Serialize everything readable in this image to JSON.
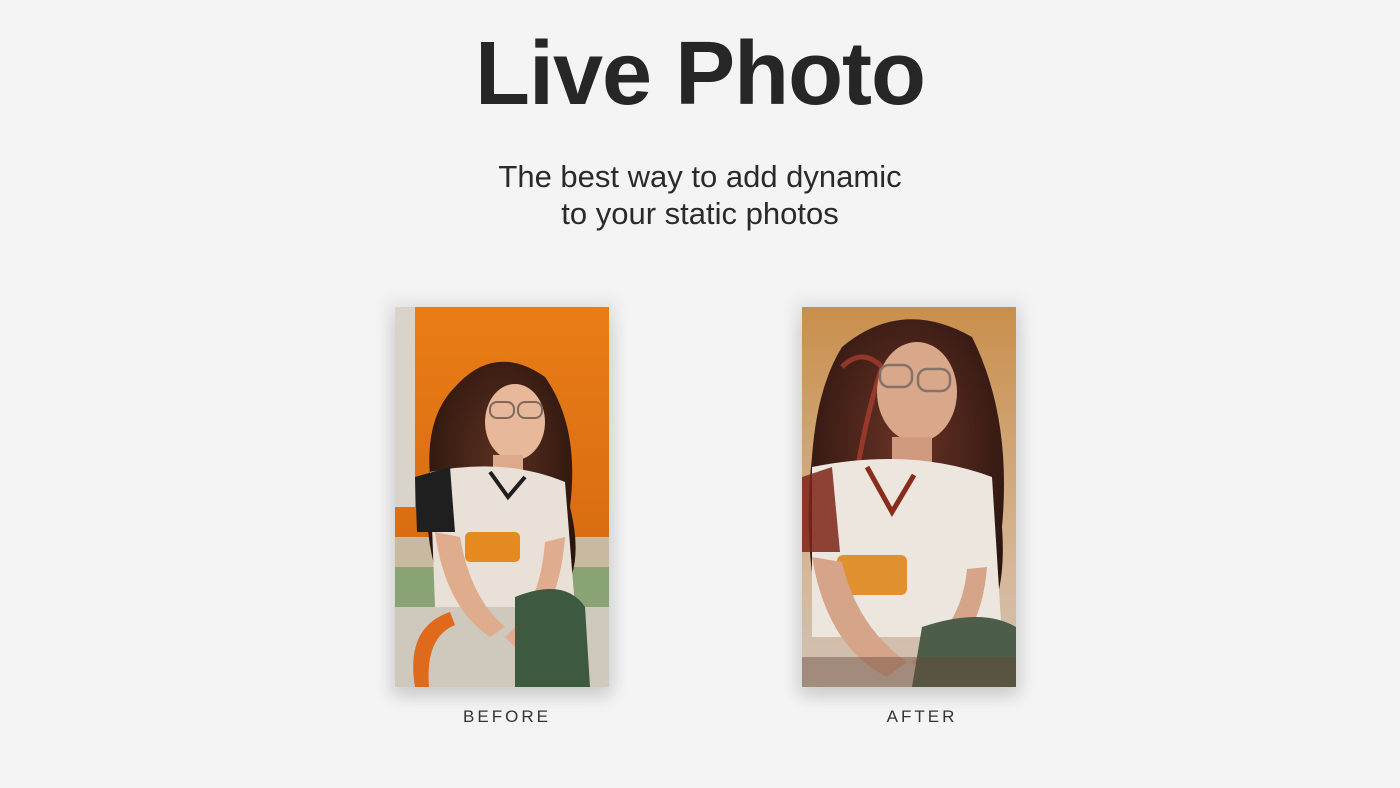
{
  "header": {
    "title": "Live Photo",
    "subtitle_line1": "The best way to add dynamic",
    "subtitle_line2": "to your static photos"
  },
  "comparison": {
    "before_label": "BEFORE",
    "after_label": "AFTER",
    "before_image": "portrait-photo-original",
    "after_image": "portrait-photo-animated"
  },
  "colors": {
    "background": "#f4f4f4",
    "title_text": "#262626",
    "photo_backdrop": "#e07a1a",
    "after_tint": "#c9a98a"
  }
}
